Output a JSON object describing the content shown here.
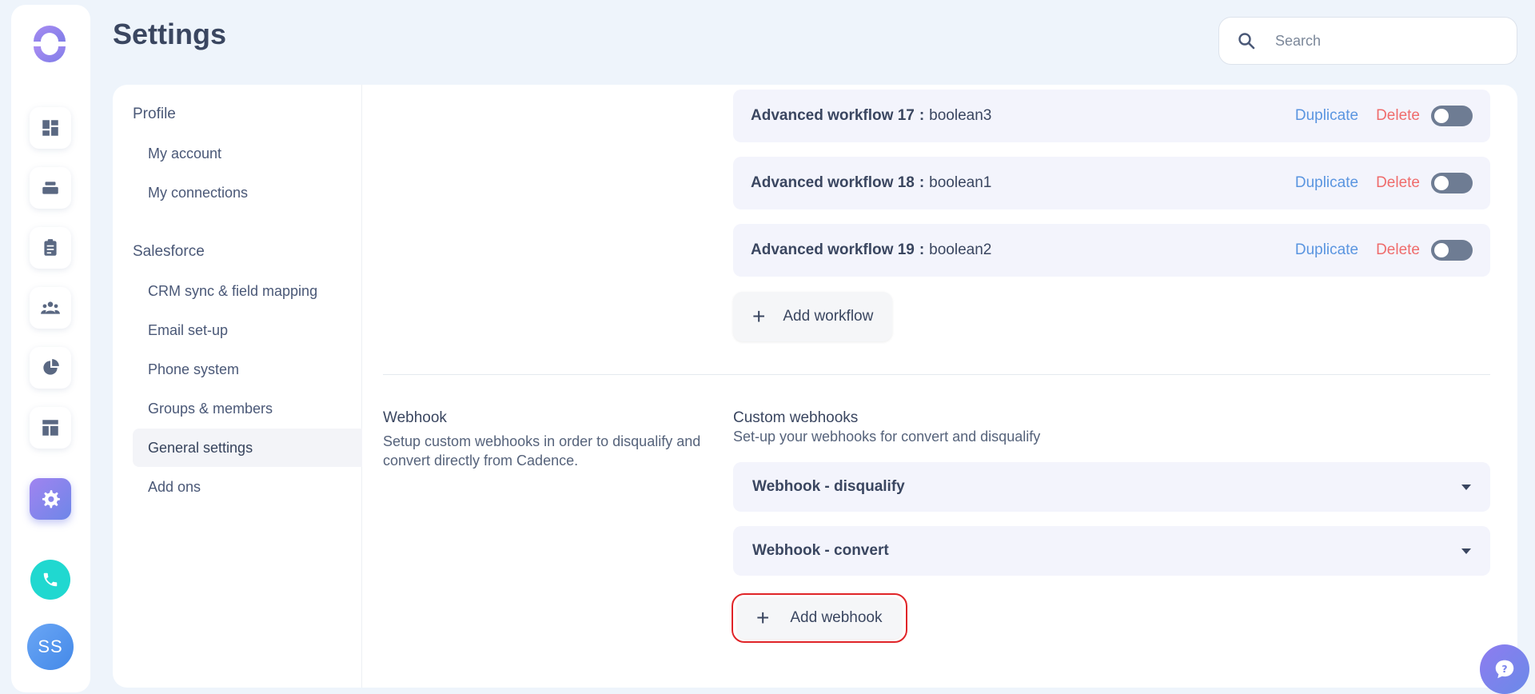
{
  "header": {
    "title": "Settings"
  },
  "search": {
    "placeholder": "Search"
  },
  "rail": {
    "items": [
      "dashboard-icon",
      "stack-icon",
      "clipboard-icon",
      "people-icon",
      "pie-chart-icon",
      "layout-icon",
      "gear-icon"
    ],
    "active": "gear-icon",
    "avatar_initials": "SS",
    "accent": "#7e85ec",
    "phone_color": "#20d8d0"
  },
  "sidebar": {
    "groups": [
      {
        "label": "Profile",
        "items": [
          "My account",
          "My connections"
        ]
      },
      {
        "label": "Salesforce",
        "items": [
          "CRM sync & field mapping",
          "Email set-up",
          "Phone system",
          "Groups & members",
          "General settings",
          "Add ons"
        ]
      }
    ],
    "active": "General settings"
  },
  "workflows": {
    "rows": [
      {
        "name": "Advanced workflow 17",
        "value": "boolean3"
      },
      {
        "name": "Advanced workflow 18",
        "value": "boolean1"
      },
      {
        "name": "Advanced workflow 19",
        "value": "boolean2"
      }
    ],
    "separator": ":",
    "duplicate_label": "Duplicate",
    "delete_label": "Delete",
    "add_label": "Add workflow"
  },
  "webhook": {
    "section_title": "Webhook",
    "section_desc": "Setup custom webhooks in order to disqualify and convert directly from Cadence.",
    "custom_title": "Custom webhooks",
    "custom_desc": "Set-up your webhooks for convert and disqualify",
    "items": [
      "Webhook - disqualify",
      "Webhook - convert"
    ],
    "add_label": "Add webhook",
    "highlight_color": "#e02428"
  },
  "colors": {
    "duplicate": "#5a95e0",
    "delete": "#ef6c6c",
    "toggle_off": "#6e7c93"
  }
}
